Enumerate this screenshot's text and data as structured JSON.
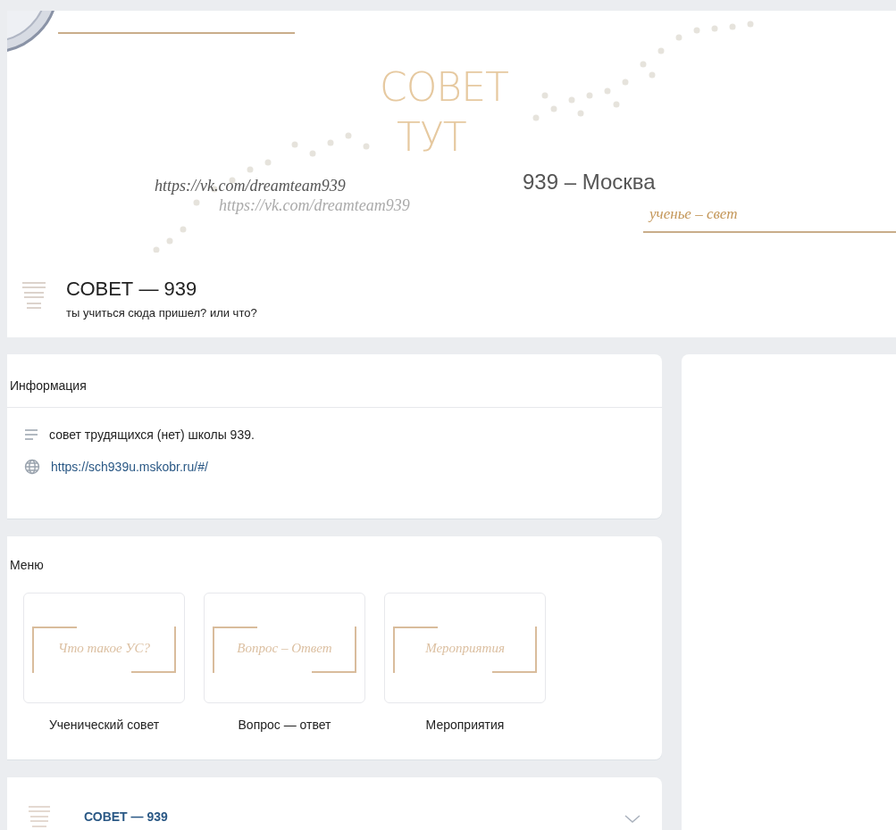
{
  "cover": {
    "title_lines": [
      "СОВЕТ",
      "ТУТ"
    ],
    "links": [
      "https://vk.com/dreamteam939",
      "https://vk.com/dreamteam939"
    ],
    "city": "939 – Москва",
    "motto": "ученье – свет"
  },
  "group": {
    "name": "СОВЕТ — 939",
    "status": "ты учиться сюда пришел? или что?"
  },
  "info": {
    "title": "Информация",
    "items": [
      {
        "kind": "description",
        "text": "совет трудящихся (нет) школы 939."
      },
      {
        "kind": "link",
        "text": "https://sch939u.mskobr.ru/#/"
      }
    ]
  },
  "menu": {
    "title": "Меню",
    "items": [
      {
        "caption": "Что такое УС?",
        "label": "Ученический совет"
      },
      {
        "caption": "Вопрос – Ответ",
        "label": "Вопрос — ответ"
      },
      {
        "caption": "Мероприятия",
        "label": "Мероприятия"
      }
    ]
  },
  "post": {
    "author": "СОВЕТ — 939"
  }
}
